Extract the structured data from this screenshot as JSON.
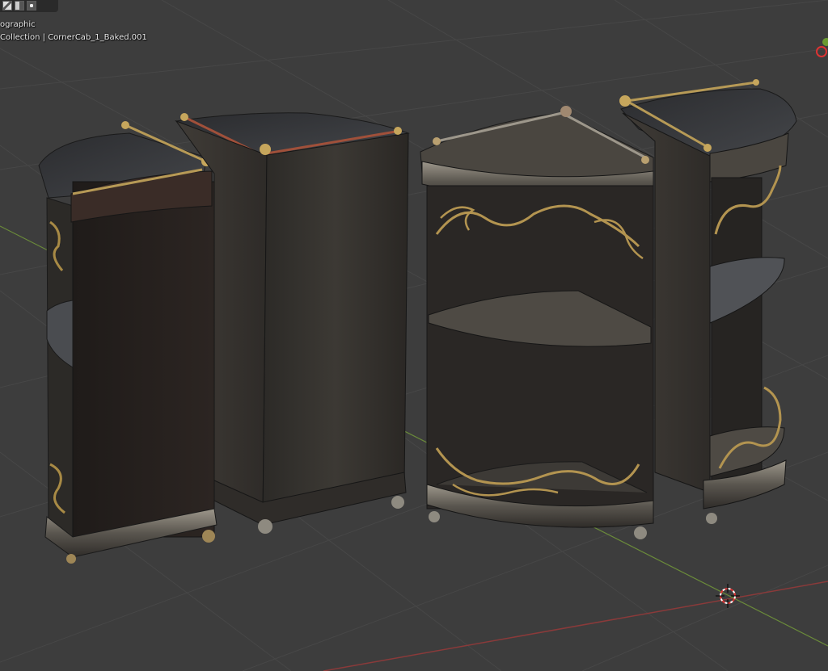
{
  "viewport": {
    "view_name": "ographic",
    "object_info": "Collection | CornerCab_1_Baked.001"
  },
  "colors": {
    "background": "#3d3d3d",
    "grid": "#4a4a4a",
    "x_axis": "#8a3a3a",
    "y_axis": "#6a8a3a",
    "wood_dark": "#2a2826",
    "wood_mid": "#3b3835",
    "metal": "#8e8a80",
    "brass": "#a88a45"
  },
  "icons": {
    "shading_mode": "solid-shading-icon",
    "material_preview": "material-preview-icon",
    "rendered": "rendered-shading-icon",
    "cursor": "3d-cursor-icon",
    "gizmo": "axis-gizmo-icon"
  }
}
